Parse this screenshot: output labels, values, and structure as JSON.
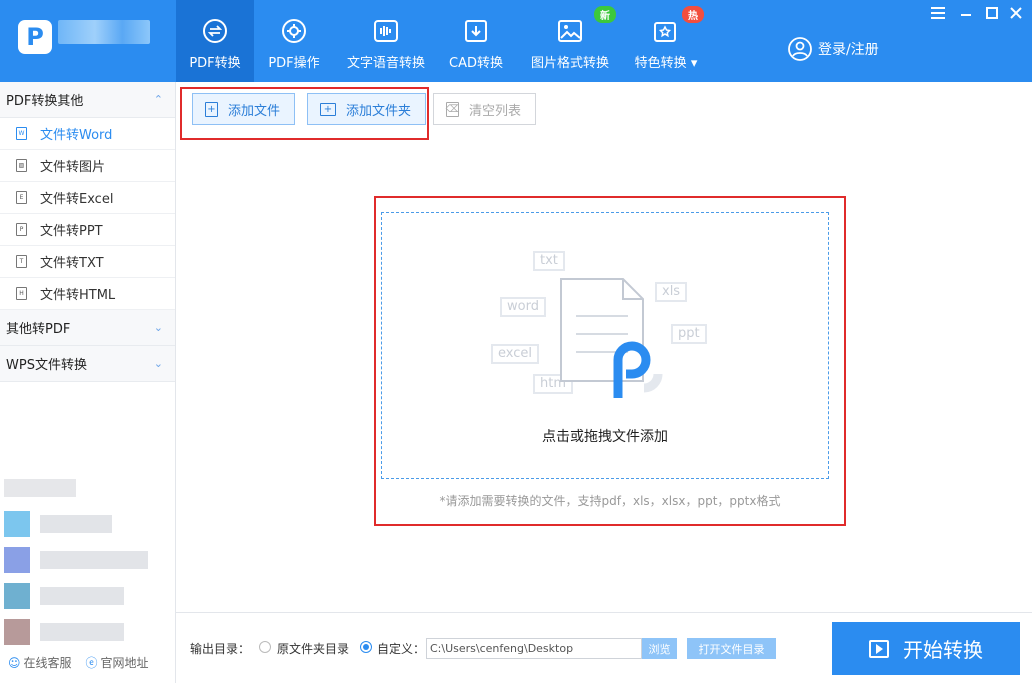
{
  "app": {
    "logo_letter": "P",
    "accent": "#2b8cf0"
  },
  "nav": {
    "tabs": [
      {
        "label": "PDF转换",
        "icon": "swap-icon",
        "active": true
      },
      {
        "label": "PDF操作",
        "icon": "gear-icon"
      },
      {
        "label": "文字语音转换",
        "icon": "audio-wave-icon"
      },
      {
        "label": "CAD转换",
        "icon": "cad-icon"
      },
      {
        "label": "图片格式转换",
        "icon": "image-icon",
        "badge": "新"
      },
      {
        "label": "特色转换",
        "icon": "star-box-icon",
        "badge": "热",
        "dropdown": "▾"
      }
    ],
    "login_label": "登录/注册"
  },
  "sidebar": {
    "groups": [
      {
        "label": "PDF转换其他",
        "chevron": "⌃"
      },
      {
        "label": "其他转PDF",
        "chevron": "⌄"
      },
      {
        "label": "WPS文件转换",
        "chevron": "⌄"
      }
    ],
    "items": [
      {
        "label": "文件转Word",
        "glyph": "W",
        "active": true
      },
      {
        "label": "文件转图片",
        "glyph": "▨"
      },
      {
        "label": "文件转Excel",
        "glyph": "E"
      },
      {
        "label": "文件转PPT",
        "glyph": "P"
      },
      {
        "label": "文件转TXT",
        "glyph": "T"
      },
      {
        "label": "文件转HTML",
        "glyph": "H"
      }
    ],
    "footer": {
      "service_label": "在线客服",
      "site_label": "官网地址"
    }
  },
  "toolbar": {
    "add_file": "添加文件",
    "add_folder": "添加文件夹",
    "clear_list": "清空列表"
  },
  "dropzone": {
    "title": "点击或拖拽文件添加",
    "hint": "*请添加需要转换的文件，支持pdf，xls，xlsx，ppt，pptx格式",
    "ghost_tags": [
      "txt",
      "word",
      "xls",
      "ppt",
      "excel",
      "htm"
    ]
  },
  "output": {
    "label": "输出目录：",
    "option_original": "原文件夹目录",
    "option_custom": "自定义：",
    "selected": "custom",
    "path": "C:\\Users\\cenfeng\\Desktop",
    "browse": "浏览",
    "open_dir": "打开文件目录"
  },
  "start_button": "开始转换"
}
